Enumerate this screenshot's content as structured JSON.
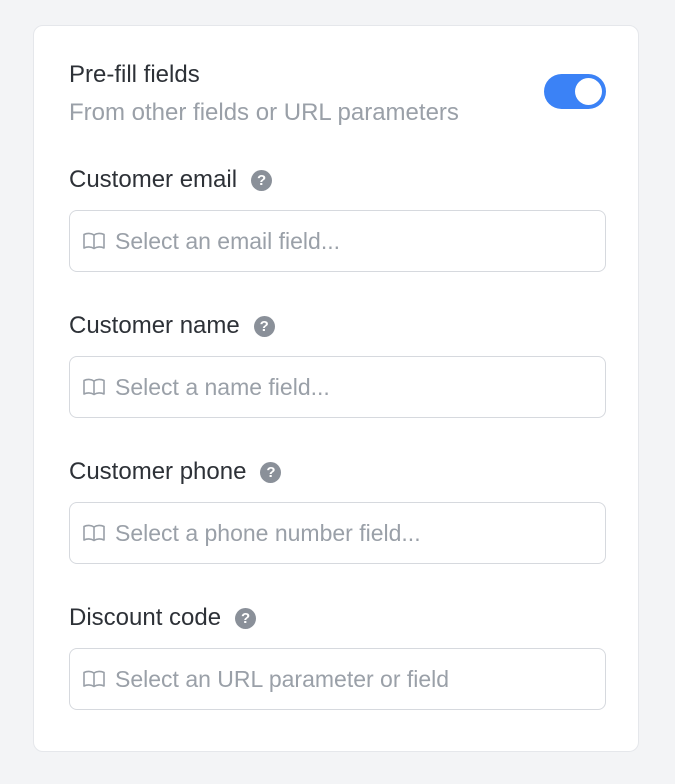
{
  "prefill": {
    "title": "Pre-fill fields",
    "subtitle": "From other fields or URL parameters",
    "toggle_on": true
  },
  "fields": [
    {
      "label": "Customer email",
      "placeholder": "Select an email field..."
    },
    {
      "label": "Customer name",
      "placeholder": "Select a name field..."
    },
    {
      "label": "Customer phone",
      "placeholder": "Select a phone number field..."
    },
    {
      "label": "Discount code",
      "placeholder": "Select an URL parameter or field"
    }
  ],
  "icons": {
    "help": "question-mark-circle-icon",
    "select": "book-open-icon"
  },
  "colors": {
    "accent": "#3b82f6",
    "text": "#2d3137",
    "muted": "#9aa0a8"
  }
}
